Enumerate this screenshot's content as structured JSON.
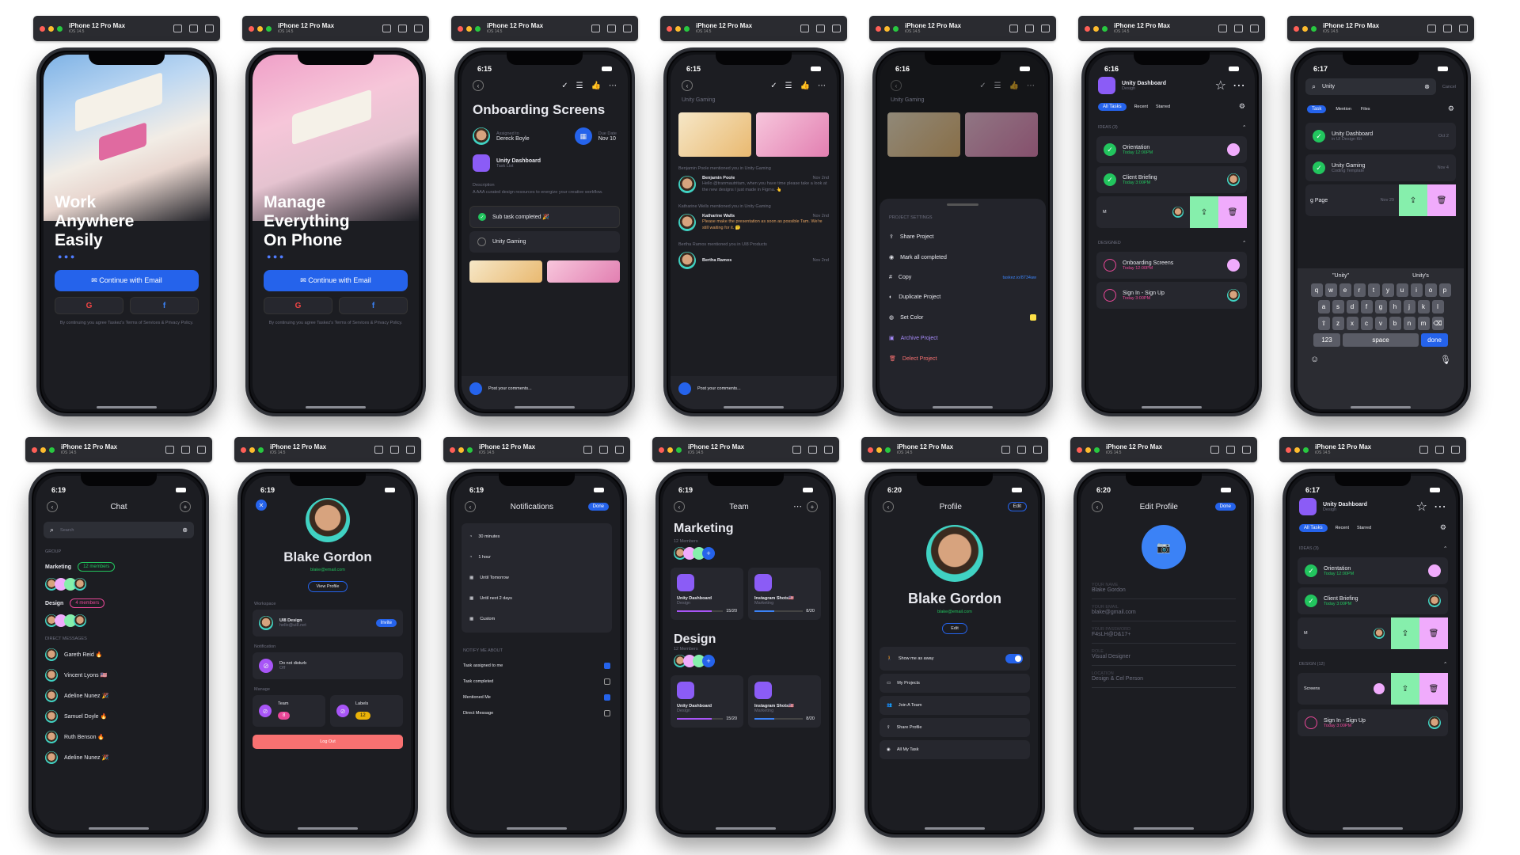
{
  "device": {
    "name": "iPhone 12 Pro Max",
    "os": "iOS 14.5"
  },
  "s1": {
    "time": "",
    "headline": [
      "Work",
      "Anywhere",
      "Easily"
    ],
    "cta": "Continue with Email",
    "terms": "By continuing you agree Taskez's Terms of Services & Privacy Policy."
  },
  "s2": {
    "headline": [
      "Manage",
      "Everything",
      "On Phone"
    ],
    "cta": "Continue with Email",
    "terms": "By continuing you agree Taskez's Terms of Services & Privacy Policy."
  },
  "s3": {
    "time": "6:15",
    "title": "Onboarding Screens",
    "assigned_label": "Assigned to",
    "assignee": "Dereck Boyle",
    "due_label": "Due Date",
    "due": "Nov 10",
    "project": "Unity Dashboard",
    "project_sub": "Task List",
    "desc_label": "Description",
    "desc": "A AAA curated design resources to energize your creative workflow.",
    "sub1": "Sub task completed 🎉",
    "sub2": "Unity Gaming",
    "comment_ph": "Post your comments..."
  },
  "s4": {
    "time": "6:15",
    "top": "Unity Gaming",
    "m1_head": "Benjamin Poole mentioned you in Unity Gaming",
    "m1_name": "Benjamin Poole",
    "m1_date": "Nov 2nd",
    "m1_text": "Hello @tranmautritam, when you have time please take a look at the new designs I just made in Figma. 👆",
    "m2_head": "Katharine Wells mentioned you in Unity Gaming",
    "m2_name": "Katharine Walls",
    "m2_date": "Nov 2nd",
    "m2_text": "Please make the presentation as soon as possible Tam. We're still waiting for it. 🤔",
    "m3_head": "Bertha Ramos mentioned you in UI8 Products",
    "m3_name": "Bertha Ramos",
    "m3_date": "Nov 2nd",
    "comment_ph": "Post your comments..."
  },
  "s5": {
    "time": "6:16",
    "top": "Unity Gaming",
    "section": "PROJECT SETTINGS",
    "items": [
      "Share Project",
      "Mark all completed",
      "Copy",
      "Duplicate Project",
      "Set Color",
      "Archive Project",
      "Delect Project"
    ],
    "copy_link": "taskez.io/8734aw"
  },
  "s6": {
    "time": "6:16",
    "title": "Unity Dashboard",
    "sub": "Design",
    "tabs": [
      "All Tasks",
      "Recent",
      "Starred"
    ],
    "g1": "IDEAS (3)",
    "t1": "Orientation",
    "t1d": "Today 12:00PM",
    "t2": "Client Briefing",
    "t2d": "Today 3:00PM",
    "swipe_l": "M",
    "g2": "DESIGNED",
    "t3": "Onboarding Screens",
    "t3d": "Today 12:00PM",
    "t4": "Sign In - Sign Up",
    "t4d": "Today 3:00PM"
  },
  "s7": {
    "time": "6:17",
    "search": "Unity",
    "cancel": "Cancel",
    "tabs": [
      "Task",
      "Mention",
      "Files"
    ],
    "r1": "Unity Dashboard",
    "r1s": "in UI Design Kit",
    "r1d": "Oct 2",
    "r2": "Unity Gaming",
    "r2s": "Coding Template",
    "r2d": "Nov 4",
    "r3": "g Page",
    "r3d": "Nov 29",
    "sugg": [
      "\"Unity\"",
      "Unity's"
    ],
    "keys1": [
      "q",
      "w",
      "e",
      "r",
      "t",
      "y",
      "u",
      "i",
      "o",
      "p"
    ],
    "keys2": [
      "a",
      "s",
      "d",
      "f",
      "g",
      "h",
      "j",
      "k",
      "l"
    ],
    "keys3": [
      "z",
      "x",
      "c",
      "v",
      "b",
      "n",
      "m"
    ],
    "k123": "123",
    "space": "space",
    "done": "done"
  },
  "s8": {
    "time": "6:19",
    "title": "Chat",
    "search_ph": "Search",
    "group": "GROUP",
    "g1": "Marketing",
    "g1b": "12 members",
    "g2": "Design",
    "g2b": "4 members",
    "dm": "DIRECT MESSAGES",
    "people": [
      "Gareth Reid 🔥",
      "Vincent Lyons 🇺🇸",
      "Adeline Nunez 🎉",
      "Samuel Doyle 🔥",
      "Ruth Benson 🔥",
      "Adeline Nunez 🎉"
    ]
  },
  "s9": {
    "time": "6:19",
    "name": "Blake Gordon",
    "email": "blake@email.com",
    "view": "View Profile",
    "ws_label": "Workspace",
    "ws": "UI8 Design",
    "ws_sub": "hello@ui8.net",
    "invite": "Invite",
    "notif_label": "Notification",
    "dnd": "Do not disturb",
    "dnd_sub": "Off",
    "manage": "Manage",
    "team": "Team",
    "team_n": "8",
    "labels": "Labels",
    "labels_n": "12",
    "logout": "Log Out"
  },
  "s10": {
    "time": "6:19",
    "title": "Notifications",
    "done": "Done",
    "opts": [
      "30 minutes",
      "1 hour",
      "Until Tomorrow",
      "Until next 2 days",
      "Custom"
    ],
    "notify": "NOTIFY ME ABOUT",
    "checks": [
      {
        "l": "Task assigned to me",
        "on": true
      },
      {
        "l": "Task completed",
        "on": false
      },
      {
        "l": "Mentioned Me",
        "on": true
      },
      {
        "l": "Direct Message",
        "on": false
      }
    ]
  },
  "s11": {
    "time": "6:19",
    "title": "Team",
    "m": "Marketing",
    "m_sub": "12 Members",
    "d": "Design",
    "d_sub": "12 Members",
    "c1": "Unity Dashboard",
    "c1s": "Design",
    "c1p": "15/20",
    "c2": "Instagram Shots🇺🇸",
    "c2s": "Marketing",
    "c2p": "8/20"
  },
  "s12": {
    "time": "6:20",
    "title": "Profile",
    "edit": "Edit",
    "name": "Blake Gordon",
    "email": "blake@email.com",
    "edit_btn": "Edit",
    "away": "Show me as away",
    "menu": [
      "My Projects",
      "Join A Team",
      "Share Profile",
      "All My Task"
    ]
  },
  "s13": {
    "time": "6:20",
    "title": "Edit Profile",
    "done": "Done",
    "fields": [
      {
        "l": "YOUR NAME",
        "v": "Blake Gordon"
      },
      {
        "l": "YOUR EMAIL",
        "v": "blake@gmail.com"
      },
      {
        "l": "YOUR PASSWORD",
        "v": "F4sLH@D&17+"
      },
      {
        "l": "ROLE",
        "v": "Visual Designer"
      },
      {
        "l": "LOCATION",
        "v": "Design & Cel Person"
      }
    ]
  },
  "s14": {
    "time": "6:17",
    "title": "Unity Dashboard",
    "sub": "Design",
    "tabs": [
      "All Tasks",
      "Recent",
      "Starred"
    ],
    "g1": "IDEAS (3)",
    "t1": "Orientation",
    "t1d": "Today 12:00PM",
    "t2": "Client Briefing",
    "t2d": "Today 3:00PM",
    "swipe_l": "M",
    "g2": "DESIGN (12)",
    "t3": "Screens",
    "t4": "Sign In - Sign Up",
    "t4d": "Today 3:00PM"
  }
}
